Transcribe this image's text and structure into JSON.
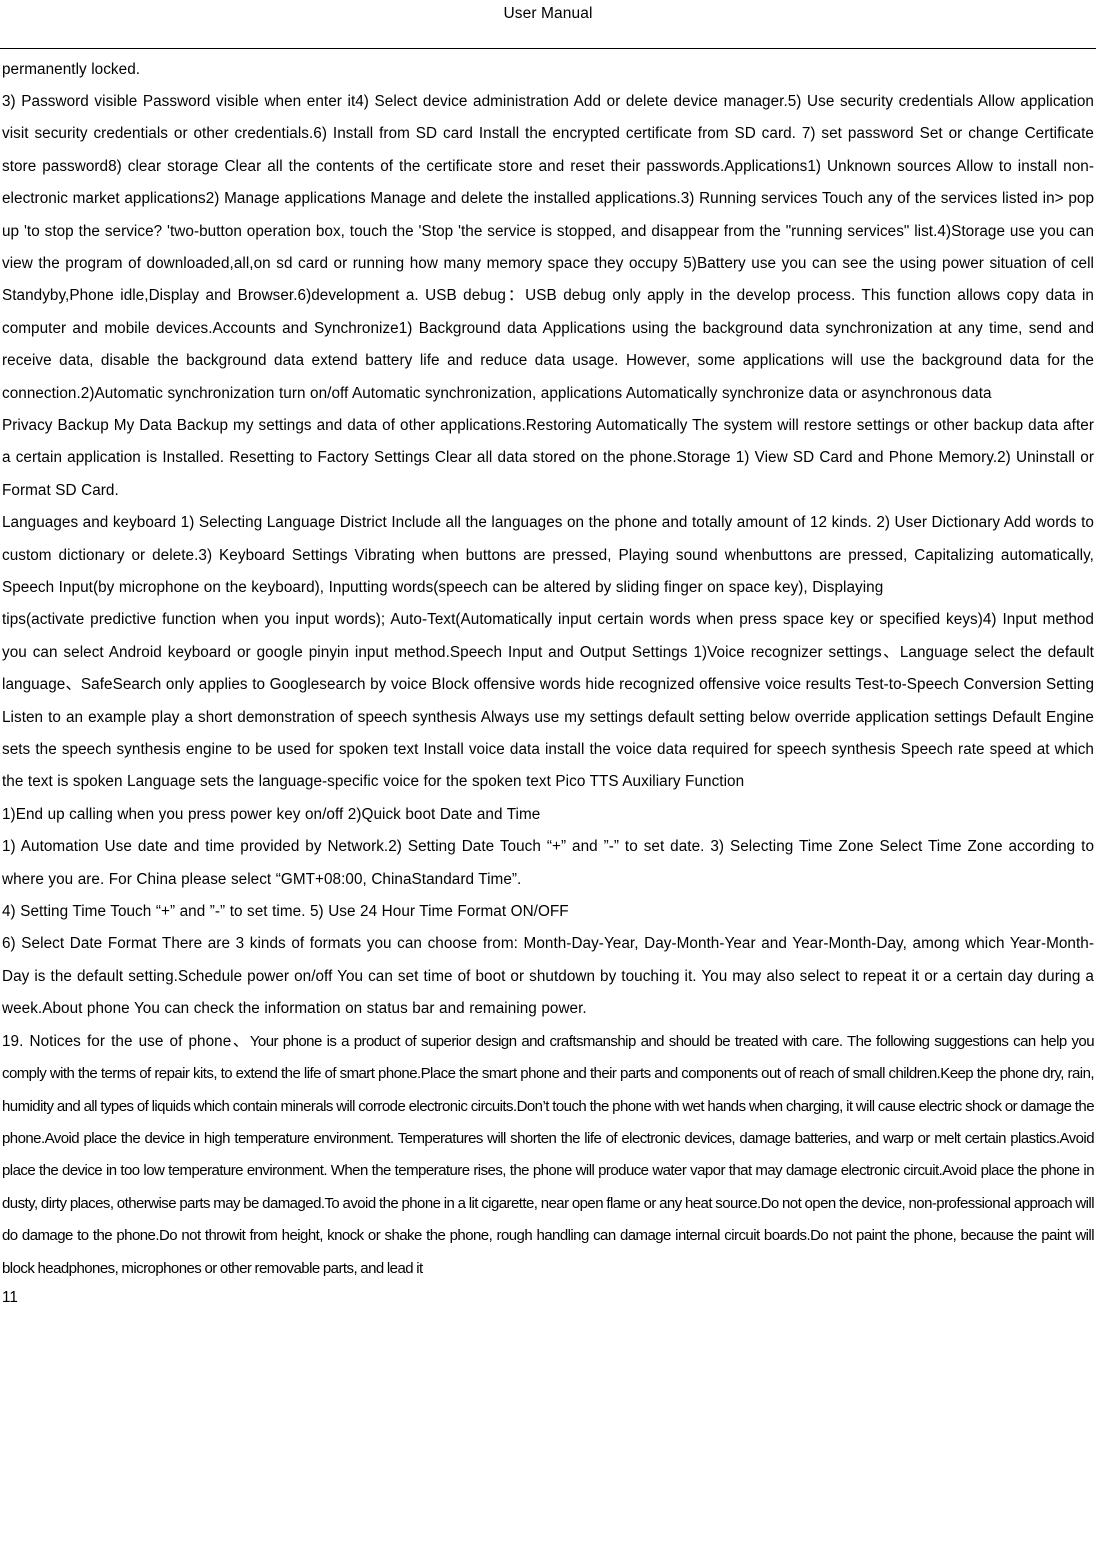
{
  "header": {
    "title": "User Manual"
  },
  "footer": {
    "page_number": "11"
  },
  "body": {
    "paragraphs": [
      {
        "id": "p-permanently-locked",
        "text": "permanently locked."
      },
      {
        "id": "p-security-credentials",
        "text": "3)   Password visible      Password visible when enter it4)   Select device administration     Add or delete device manager.5)   Use security credentials      Allow application visit security credentials or other credentials.6)   Install from SD card     Install the encrypted certificate from SD card. 7)   set password      Set or change Certificate store password8)   clear storage      Clear all the contents of the certificate store and reset their passwords.Applications1) Unknown sources   Allow to install non-electronic market applications2) Manage applications       Manage and delete the installed applications.3) Running services     Touch any of the services listed in> pop up 'to stop the service? 'two-button operation box, touch the 'Stop 'the service is stopped, and disappear from the \"running services\" list.4)Storage use       you can view the program of downloaded,all,on sd card or running   how many memory space they occupy 5)Battery use       you can see the using power situation of cell Standyby,Phone idle,Display and Browser.6)development     a. USB debug：USB debug only apply in the develop process. This function allows copy data in computer and mobile devices.Accounts and Synchronize1) Background data      Applications using the background data synchronization at any time, send and receive data, disable the background data extend battery life and reduce data usage. However, some applications will use the background data for the connection.2)Automatic synchronization   turn on/off Automatic synchronization, applications Automatically synchronize data or asynchronous data"
      },
      {
        "id": "p-privacy-backup",
        "text": "Privacy Backup My Data      Backup my settings and data of other applications.Restoring Automatically      The system will restore settings or other backup data after a certain application is Installed.   Resetting to Factory Settings      Clear all data stored on the phone.Storage 1) View SD Card and Phone Memory.2) Uninstall or Format SD Card."
      },
      {
        "id": "p-languages-keyboard",
        "text": "Languages and keyboard 1) Selecting Language District      Include all the languages on the phone and totally amount of 12 kinds. 2) User Dictionary        Add words to custom dictionary or delete.3) Keyboard Settings      Vibrating when buttons are pressed, Playing sound whenbuttons are pressed, Capitalizing automatically, Speech Input(by microphone on the keyboard), Inputting words(speech can be altered by sliding finger on space key), Displaying"
      },
      {
        "id": "p-tips-speech",
        "text": "tips(activate predictive function when you input words); Auto-Text(Automatically input certain words when press space key or specified keys)4) Input method      you can select Android keyboard or google pinyin input method.Speech Input and Output Settings 1)Voice recognizer settings、Language   select the default language、SafeSearch only applies to Googlesearch by voice Block offensive words     hide recognized offensive voice results   Test-to-Speech Conversion Setting Listen to an example   play a short demonstration of speech synthesis   Always use my settings       default setting below override application settings Default Engine     sets the speech synthesis engine to be used for spoken text Install voice data   install the voice data required for speech synthesis Speech rate                  speed at which the text is spoken Language   sets the language-specific voice for the spoken text Pico TTS Auxiliary Function"
      },
      {
        "id": "p-power-key",
        "text": "1)End up calling when you press power key      on/off   2)Quick boot   Date and Time"
      },
      {
        "id": "p-automation-timezone",
        "text": "1) Automation      Use date and time provided by Network.2) Setting Date      Touch “+” and ”-” to set date.     3) Selecting Time Zone       Select Time Zone according to where you are. For China please select “GMT+08:00, ChinaStandard Time”."
      },
      {
        "id": "p-setting-time",
        "text": "4) Setting Time       Touch “+” and ”-” to set time.       5) Use 24 Hour Time Format       ON/OFF"
      },
      {
        "id": "p-date-format",
        "text": "6) Select Date Format        There are 3 kinds of formats you can choose from: Month-Day-Year, Day-Month-Year and Year-Month-Day, among which Year-Month-Day is the default setting.Schedule power on/off   You can set time of boot or shutdown by touching it. You may also select to repeat it or a certain day during a week.About phone You can check the information on status bar and remaining power."
      }
    ],
    "notices": {
      "lead": "19. Notices for the use of phone、",
      "condensed_text": "Your phone is a product of superior design and craftsmanship and should be treated with care. The following suggestions can help you comply with the terms of repair kits, to extend the life of smart phone.Place the smart phone and their parts and components out of reach of small children.Keep the phone dry, rain, humidity and all types of liquids which contain minerals will corrode electronic circuits.Don’t touch the phone with wet hands when charging, it will cause electric shock or damage the phone.Avoid place the device in high temperature environment. Temperatures will shorten the life of electronic devices, damage batteries, and warp or melt certain plastics.Avoid place the device in too low temperature environment. When the temperature rises, the phone will produce water vapor that may damage   electronic circuit.Avoid place the phone in dusty, dirty places, otherwise parts may be damaged.To avoid the phone in a lit cigarette, near open flame or any heat source.Do not open the device, non-professional approach will do damage to the phone.Do not throwit from height, knock or shake the phone, rough handling can damage internal circuit boards.Do not paint the phone, because the paint will block headphones, microphones or other removable parts, and lead it"
    }
  }
}
